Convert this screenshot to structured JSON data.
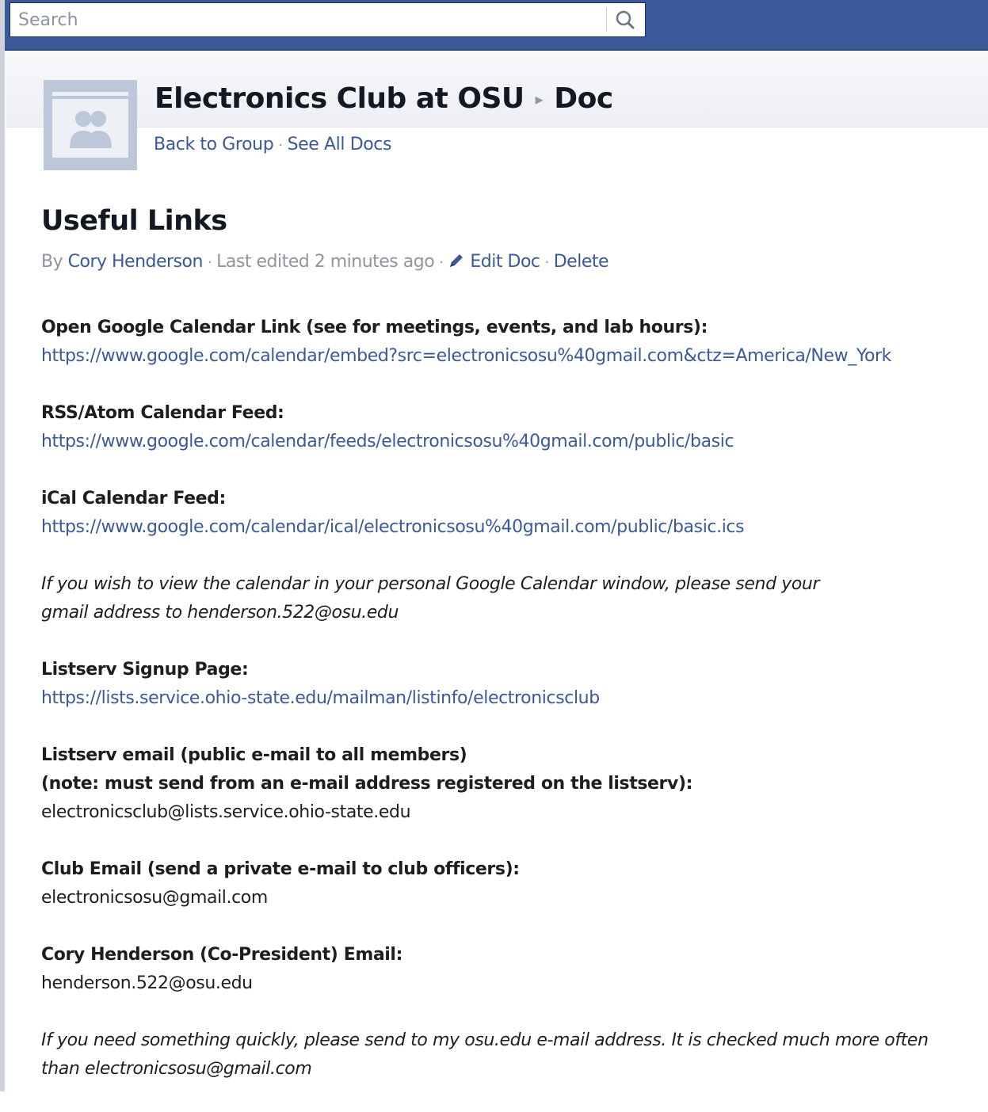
{
  "search": {
    "placeholder": "Search",
    "icon": "search-icon"
  },
  "header": {
    "group_name": "Electronics Club at OSU",
    "separator": "▸",
    "section": "Doc",
    "back_link": "Back to Group",
    "nav_separator": "·",
    "all_docs_link": "See All Docs"
  },
  "doc": {
    "title": "Useful Links",
    "by_label": "By",
    "author": "Cory Henderson",
    "last_edited": "Last edited 2 minutes ago",
    "edit_label": "Edit Doc",
    "delete_label": "Delete"
  },
  "sections": {
    "calendar_link": {
      "heading": "Open Google Calendar Link (see for meetings, events, and lab hours):",
      "url": "https://www.google.com/calendar/embed?src=electronicsosu%40gmail.com&ctz=America/New_York"
    },
    "rss_feed": {
      "heading": "RSS/Atom Calendar Feed:",
      "url": "https://www.google.com/calendar/feeds/electronicsosu%40gmail.com/public/basic"
    },
    "ical_feed": {
      "heading": "iCal Calendar Feed:",
      "url": "https://www.google.com/calendar/ical/electronicsosu%40gmail.com/public/basic.ics"
    },
    "calendar_note": {
      "line1": "If you wish to view the calendar in your personal Google Calendar window, please send your",
      "line2": "gmail address to henderson.522@osu.edu"
    },
    "listserv_signup": {
      "heading": "Listserv Signup Page:",
      "url": "https://lists.service.ohio-state.edu/mailman/listinfo/electronicsclub"
    },
    "listserv_email": {
      "heading1": "Listserv email (public e-mail to all members)",
      "heading2": "(note: must send from an e-mail address registered on the listserv):",
      "address": "electronicsclub@lists.service.ohio-state.edu"
    },
    "club_email": {
      "heading": "Club Email (send a private e-mail to club officers):",
      "address": "electronicsosu@gmail.com"
    },
    "president_email": {
      "heading": "Cory Henderson (Co-President) Email:",
      "address": "henderson.522@osu.edu"
    },
    "closing_note": {
      "line1": "If you need something quickly, please send to my osu.edu e-mail address. It is checked much more often",
      "line2": "than electronicsosu@gmail.com"
    }
  }
}
